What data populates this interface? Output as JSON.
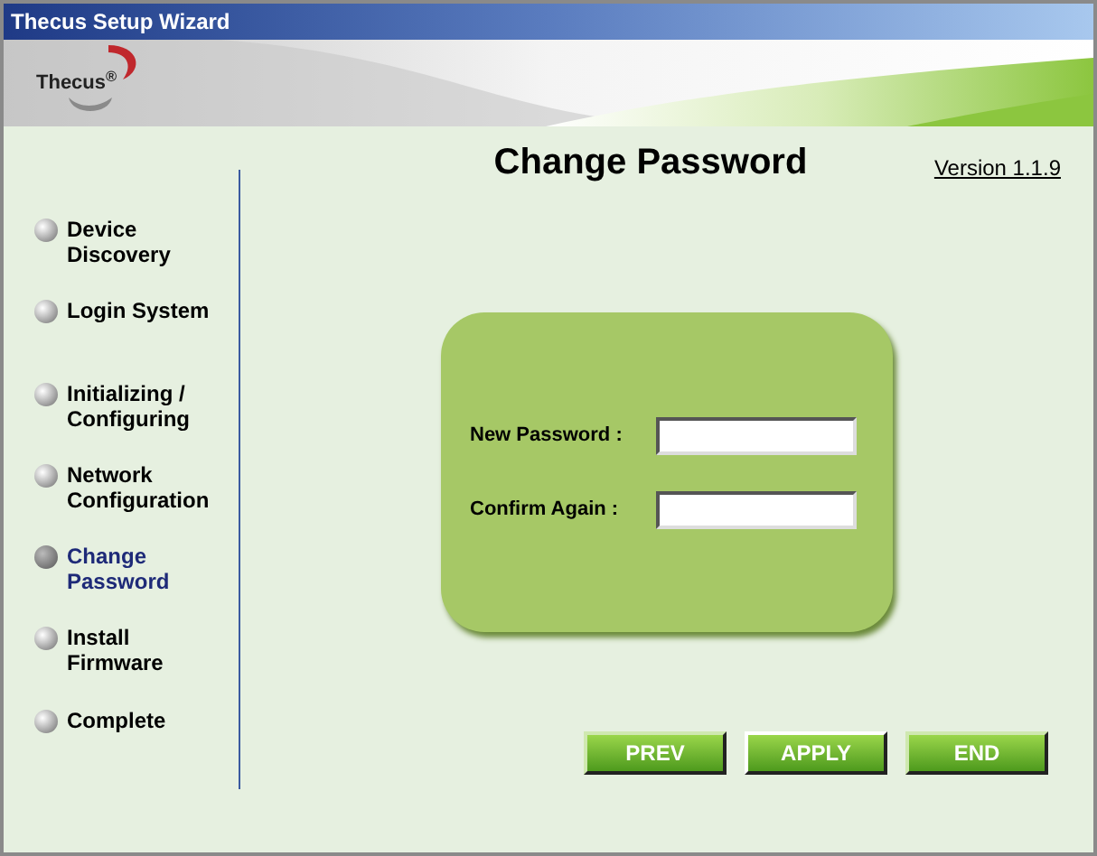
{
  "window": {
    "title": "Thecus Setup Wizard"
  },
  "logo": {
    "text": "Thecus$^{®}$"
  },
  "page": {
    "title": "Change Password",
    "version": "Version 1.1.9"
  },
  "steps": [
    {
      "label": "Device Discovery",
      "selected": false
    },
    {
      "label": "Login System",
      "selected": false
    },
    {
      "label": "Initializing / Configuring",
      "selected": false
    },
    {
      "label": "Network Configuration",
      "selected": false
    },
    {
      "label": "Change Password",
      "selected": true
    },
    {
      "label": "Install Firmware",
      "selected": false
    },
    {
      "label": "Complete",
      "selected": false
    }
  ],
  "form": {
    "fields": [
      {
        "label": "New Password :"
      },
      {
        "label": "Confirm Again :"
      }
    ]
  },
  "buttons": [
    {
      "label": "PREV",
      "selected": false
    },
    {
      "label": "APPLY",
      "selected": true
    },
    {
      "label": "END",
      "selected": false
    }
  ]
}
